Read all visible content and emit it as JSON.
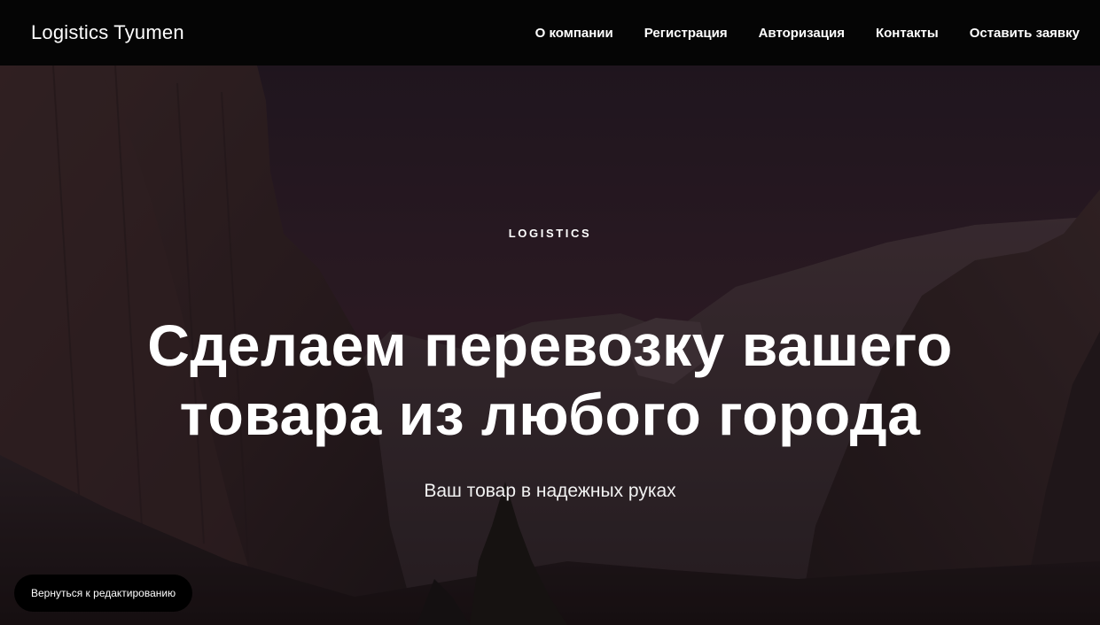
{
  "navbar": {
    "brand": "Logistics Tyumen",
    "links": [
      {
        "label": "О компании"
      },
      {
        "label": "Регистрация"
      },
      {
        "label": "Авторизация"
      },
      {
        "label": "Контакты"
      },
      {
        "label": "Оставить заявку"
      }
    ]
  },
  "hero": {
    "eyebrow": "LOGISTICS",
    "headline_line1": "Сделаем перевозку вашего",
    "headline_line2": "товара из любого города",
    "subtitle": "Ваш товар в надежных руках",
    "background": "mountain-valley-photo"
  },
  "edit_button": {
    "label": "Вернуться к редактированию"
  },
  "colors": {
    "nav_background": "#050505",
    "text": "#ffffff",
    "overlay_tint": "#2e1b22"
  }
}
